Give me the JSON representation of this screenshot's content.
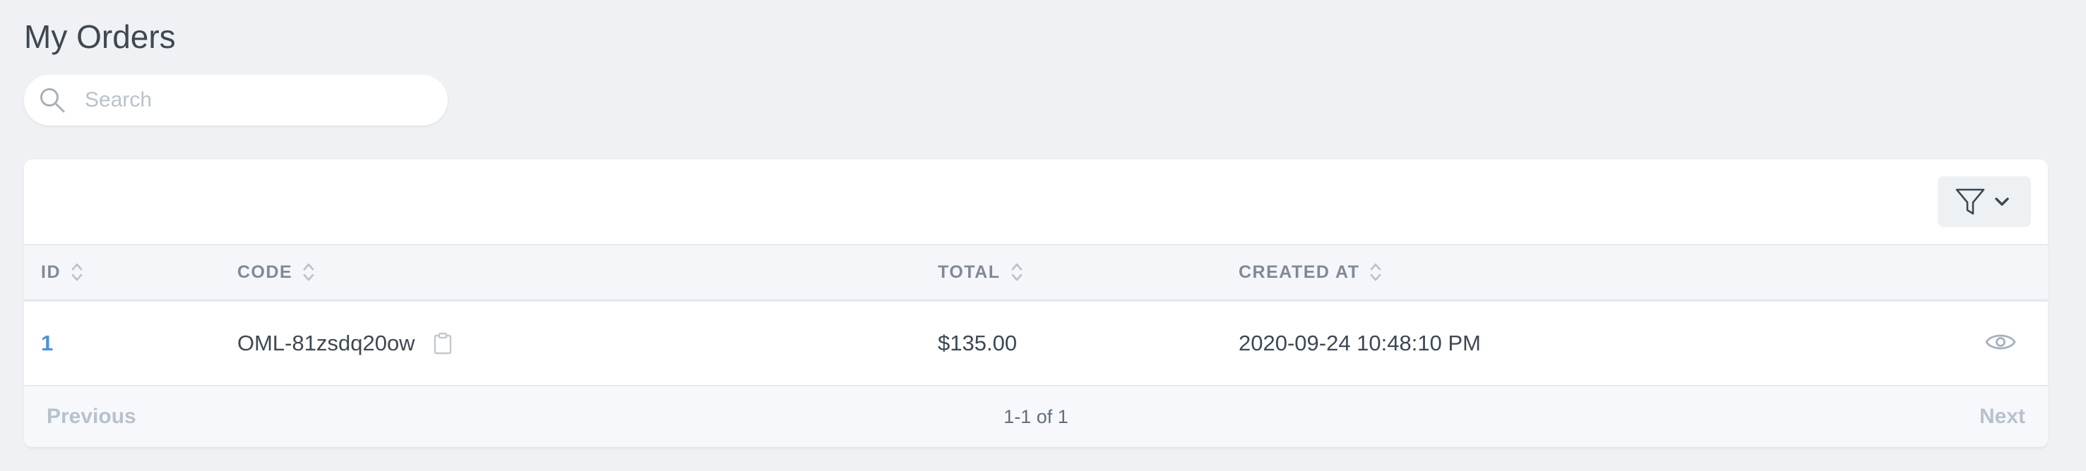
{
  "page": {
    "title": "My Orders"
  },
  "search": {
    "placeholder": "Search",
    "value": "",
    "icon": "search-icon"
  },
  "toolbar": {
    "filter_icon": "filter-icon",
    "dropdown_icon": "chevron-down-icon"
  },
  "table": {
    "columns": [
      {
        "label": "ID",
        "sortable": true
      },
      {
        "label": "CODE",
        "sortable": true
      },
      {
        "label": "TOTAL",
        "sortable": true
      },
      {
        "label": "CREATED AT",
        "sortable": true
      }
    ],
    "rows": [
      {
        "id": "1",
        "code": "OML-81zsdq20ow",
        "total": "$135.00",
        "created_at": "2020-09-24 10:48:10 PM"
      }
    ]
  },
  "pagination": {
    "previous_label": "Previous",
    "info": "1-1 of 1",
    "next_label": "Next"
  },
  "colors": {
    "background": "#eff1f5",
    "link": "#4e91d6",
    "header_text": "#7f8a96",
    "muted": "#b8c2cc"
  }
}
